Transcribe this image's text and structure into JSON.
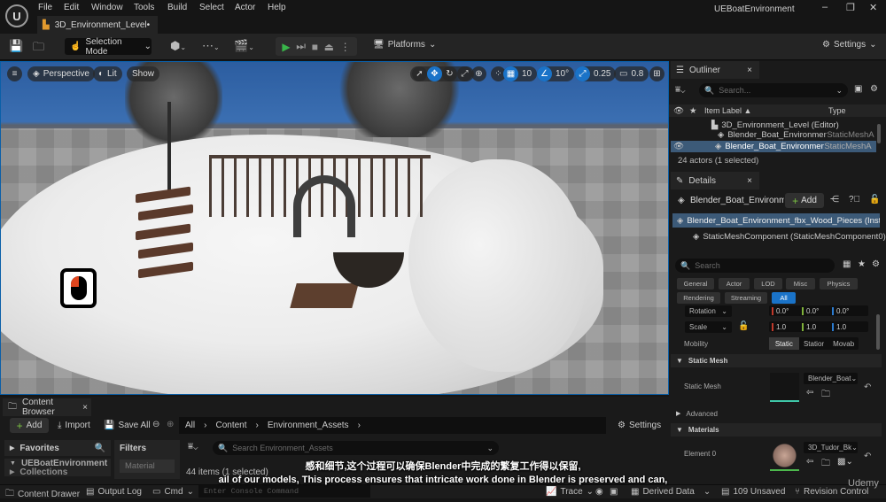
{
  "app": {
    "logo_text": "U",
    "menu": [
      "File",
      "Edit",
      "Window",
      "Tools",
      "Build",
      "Select",
      "Actor",
      "Help"
    ],
    "level_tab": "3D_Environment_Level•",
    "window_title": "UEBoatEnvironment",
    "window_controls": {
      "minimize": "–",
      "restore": "❐",
      "close": "✕"
    }
  },
  "toolbar": {
    "save_icon": "save-icon",
    "browse_icon": "browse-icon",
    "selection_mode": "Selection Mode",
    "play_icons": [
      "play",
      "skip",
      "stop",
      "eject",
      "more"
    ],
    "platforms": "Platforms",
    "settings": "Settings"
  },
  "viewport": {
    "menu_icon": "≡",
    "perspective": "Perspective",
    "lit": "Lit",
    "show": "Show",
    "grid_snap": "10",
    "rotation_snap": "10°",
    "scale_snap": "0.25",
    "camera_speed": "0.8"
  },
  "outliner": {
    "tab": "Outliner",
    "search_placeholder": "Search...",
    "col_label": "Item Label ▲",
    "col_type": "Type",
    "rows": [
      {
        "label": "3D_Environment_Level (Editor)",
        "type": ""
      },
      {
        "label": "Blender_Boat_Environmen",
        "type": "StaticMeshA"
      },
      {
        "label": "Blender_Boat_Environmen",
        "type": "StaticMeshA",
        "selected": true
      }
    ],
    "footer": "24 actors (1 selected)"
  },
  "details": {
    "tab": "Details",
    "actor_name": "Blender_Boat_Environme",
    "add_label": "Add",
    "component_root": "Blender_Boat_Environment_fbx_Wood_Pieces (Insta",
    "component_child": "StaticMeshComponent (StaticMeshComponent0)",
    "search_placeholder": "Search",
    "filters_row1": [
      "General",
      "Actor",
      "LOD",
      "Misc",
      "Physics"
    ],
    "filters_row2": [
      "Rendering",
      "Streaming",
      "All"
    ],
    "active_filter": "All",
    "rotation": {
      "label": "Rotation",
      "x": "0.0°",
      "y": "0.0°",
      "z": "0.0°"
    },
    "scale": {
      "label": "Scale",
      "x": "1.0",
      "y": "1.0",
      "z": "1.0"
    },
    "mobility": {
      "label": "Mobility",
      "options": [
        "Static",
        "Statior",
        "Movab"
      ],
      "selected": "Static"
    },
    "static_mesh_section": "Static Mesh",
    "static_mesh_label": "Static Mesh",
    "static_mesh_value": "Blender_Boat",
    "advanced": "Advanced",
    "materials_section": "Materials",
    "element0_label": "Element 0",
    "element0_value": "3D_Tudor_Bk"
  },
  "content_browser": {
    "tab": "Content Browser",
    "add": "Add",
    "import": "Import",
    "save_all": "Save All",
    "breadcrumb": [
      "All",
      "Content",
      "Environment_Assets"
    ],
    "settings": "Settings",
    "favorites": "Favorites",
    "project": "UEBoatEnvironment",
    "collections": "Collections",
    "filters": "Filters",
    "filter_item": "Material",
    "search_placeholder": "Search Environment_Assets",
    "count": "44 items (1 selected)"
  },
  "statusbar": {
    "content_drawer": "Content Drawer",
    "output_log": "Output Log",
    "cmd": "Cmd",
    "console_placeholder": "Enter Console Command",
    "trace": "Trace",
    "derived_data": "Derived Data",
    "unsaved": "109 Unsaved",
    "revision_control": "Revision Control"
  },
  "subtitles": {
    "cn": "感和细节,这个过程可以确保Blender中完成的繁复工作得以保留,",
    "en": "ail of our models, This process ensures that intricate work done in Blender is preserved and can,"
  },
  "watermark": "Udemy",
  "colors": {
    "accent": "#1a73c8",
    "play": "#39b54a",
    "selected_row": "#3c5a78"
  }
}
